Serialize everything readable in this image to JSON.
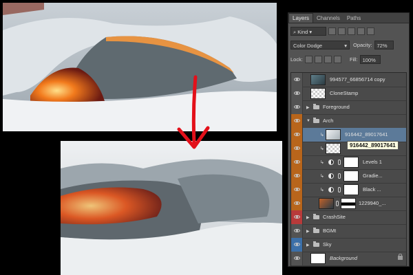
{
  "panel": {
    "tabs": [
      "Layers",
      "Channels",
      "Paths"
    ],
    "filter_kind": "Kind",
    "blend_mode": "Color Dodge",
    "opacity_label": "Opacity:",
    "opacity_value": "72%",
    "lock_label": "Lock:",
    "fill_label": "Fill:",
    "fill_value": "100%"
  },
  "layers": [
    {
      "name": "994577_66856714 copy",
      "eye": true,
      "type": "image"
    },
    {
      "name": "CloneStamp",
      "eye": true,
      "type": "transparent"
    },
    {
      "name": "Foreground",
      "eye": true,
      "type": "group"
    },
    {
      "name": "Arch",
      "eye": true,
      "type": "group-open"
    },
    {
      "name": "916442_89017641",
      "eye": true,
      "type": "clipped-image",
      "selected": true
    },
    {
      "name": "",
      "eye": true,
      "type": "clipped-transparent"
    },
    {
      "name": "Levels 1",
      "eye": true,
      "type": "adjustment"
    },
    {
      "name": "Gradie...",
      "eye": true,
      "type": "adjustment"
    },
    {
      "name": "Black ...",
      "eye": true,
      "type": "adjustment"
    },
    {
      "name": "1229940_...",
      "eye": true,
      "type": "masked-image"
    },
    {
      "name": "CrashSite",
      "eye": true,
      "type": "group"
    },
    {
      "name": "BGMt",
      "eye": true,
      "type": "group"
    },
    {
      "name": "Sky",
      "eye": true,
      "type": "group"
    },
    {
      "name": "Background",
      "eye": true,
      "type": "background"
    }
  ],
  "eye_colors": [
    "#535353",
    "#535353",
    "#535353",
    "#b8651b",
    "#b8651b",
    "#b8651b",
    "#b8651b",
    "#b8651b",
    "#b8651b",
    "#b8651b",
    "#b83a3a",
    "#535353",
    "#3b6fa8",
    "#535353"
  ],
  "tooltip": "916442_89017641",
  "colors": {
    "selected_row": "#5c7a99",
    "arrow": "#e3101a",
    "accent_orange": "#b8651b"
  }
}
